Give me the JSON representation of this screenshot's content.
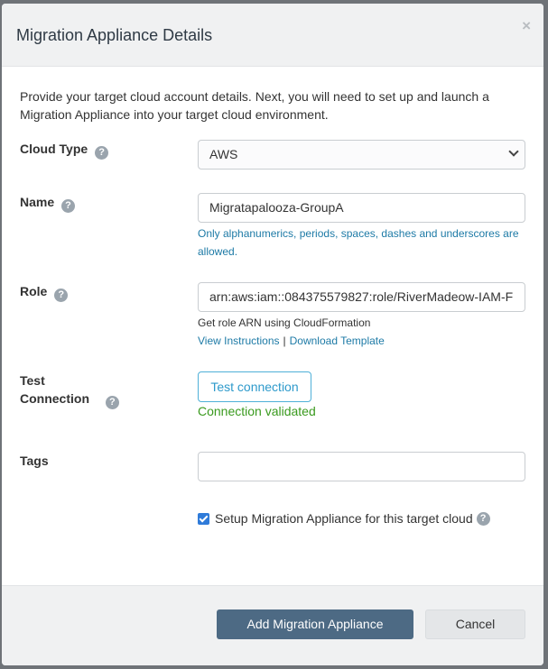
{
  "modal": {
    "title": "Migration Appliance Details",
    "close_glyph": "×",
    "intro": "Provide your target cloud account details. Next, you will need to set up and launch a Migration Appliance into your target cloud environment."
  },
  "help_glyph": "?",
  "fields": {
    "cloud_type": {
      "label": "Cloud Type",
      "value": "AWS"
    },
    "name": {
      "label": "Name",
      "value": "Migratapalooza-GroupA",
      "hint": "Only alphanumerics, periods, spaces, dashes and underscores are allowed."
    },
    "role": {
      "label": "Role",
      "value": "arn:aws:iam::084375579827:role/RiverMadeow-IAM-F",
      "hint": "Get role ARN using CloudFormation",
      "link_instructions": "View Instructions",
      "link_separator": "|",
      "link_template": "Download Template"
    },
    "test_connection": {
      "label_line1": "Test",
      "label_line2": "Connection",
      "button_label": "Test connection",
      "status": "Connection validated"
    },
    "tags": {
      "label": "Tags",
      "value": ""
    },
    "setup_checkbox": {
      "label": "Setup Migration Appliance for this target cloud",
      "checked": true
    }
  },
  "footer": {
    "primary_label": "Add Migration Appliance",
    "cancel_label": "Cancel"
  },
  "colors": {
    "primary": "#4d6a84",
    "link": "#1d7aa6",
    "success": "#3a9a1e",
    "checkbox": "#2f7bd9"
  }
}
